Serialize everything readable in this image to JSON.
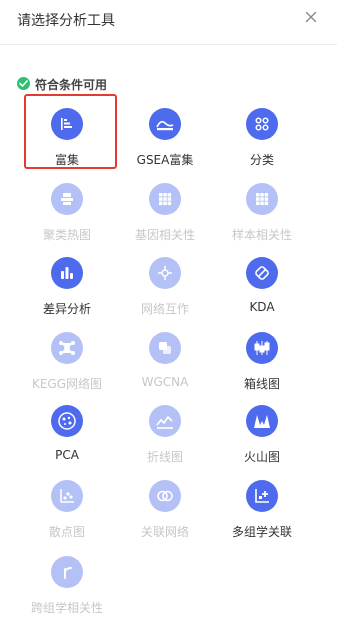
{
  "header": {
    "title": "请选择分析工具",
    "close_icon": "close-icon"
  },
  "section": {
    "label": "符合条件可用",
    "icon": "check-circle-icon",
    "icon_color": "#2fbf71"
  },
  "colors": {
    "accent": "#4f6bed",
    "disabled": "#b3c1f6",
    "selection_border": "#e53935"
  },
  "tools": [
    {
      "label": "富集",
      "icon": "enrichment-icon",
      "enabled": true,
      "selected": true
    },
    {
      "label": "GSEA富集",
      "icon": "gsea-icon",
      "enabled": true
    },
    {
      "label": "分类",
      "icon": "classification-icon",
      "enabled": true
    },
    {
      "label": "聚类热图",
      "icon": "cluster-heatmap-icon",
      "enabled": false
    },
    {
      "label": "基因相关性",
      "icon": "gene-correlation-icon",
      "enabled": false
    },
    {
      "label": "样本相关性",
      "icon": "sample-correlation-icon",
      "enabled": false
    },
    {
      "label": "差异分析",
      "icon": "differential-analysis-icon",
      "enabled": true
    },
    {
      "label": "网络互作",
      "icon": "network-interaction-icon",
      "enabled": false
    },
    {
      "label": "KDA",
      "icon": "kda-icon",
      "enabled": true
    },
    {
      "label": "KEGG网络图",
      "icon": "kegg-network-icon",
      "enabled": false
    },
    {
      "label": "WGCNA",
      "icon": "wgcna-icon",
      "enabled": false
    },
    {
      "label": "箱线图",
      "icon": "boxplot-icon",
      "enabled": true
    },
    {
      "label": "PCA",
      "icon": "pca-icon",
      "enabled": true
    },
    {
      "label": "折线图",
      "icon": "line-chart-icon",
      "enabled": false
    },
    {
      "label": "火山图",
      "icon": "volcano-plot-icon",
      "enabled": true
    },
    {
      "label": "散点图",
      "icon": "scatter-plot-icon",
      "enabled": false
    },
    {
      "label": "关联网络",
      "icon": "association-network-icon",
      "enabled": false
    },
    {
      "label": "多组学关联",
      "icon": "multi-omics-icon",
      "enabled": true
    },
    {
      "label": "跨组学相关性",
      "icon": "cross-omics-correlation-icon",
      "enabled": false
    }
  ]
}
